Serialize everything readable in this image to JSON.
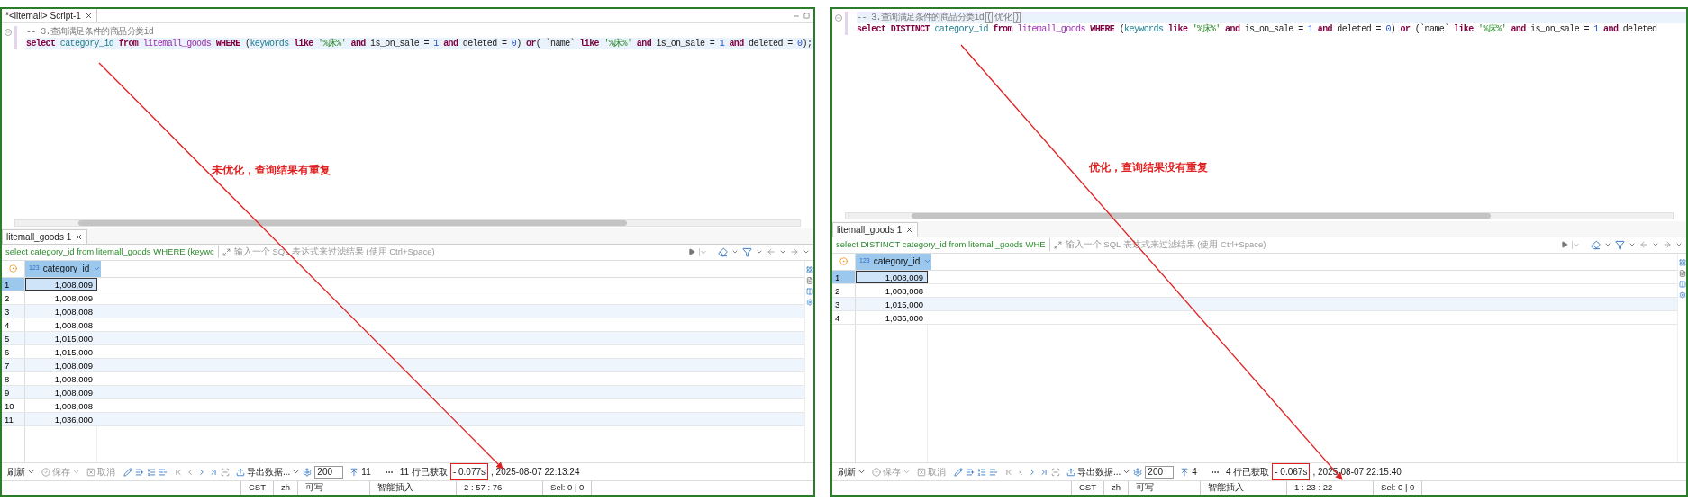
{
  "panels": [
    {
      "editor_tab": {
        "title": "*<litemall> Script-1"
      },
      "code": [
        {
          "current": false,
          "tokens": [
            {
              "kind": "comment",
              "text": "-- 3.查询满足条件的商品分类id"
            }
          ]
        },
        {
          "current": true,
          "tokens": [
            {
              "kind": "keyword",
              "text": "select "
            },
            {
              "kind": "column",
              "text": "category_id "
            },
            {
              "kind": "keyword",
              "text": "from "
            },
            {
              "kind": "table",
              "text": "litemall_goods "
            },
            {
              "kind": "keyword",
              "text": "WHERE "
            },
            {
              "kind": "plain",
              "text": "("
            },
            {
              "kind": "column",
              "text": "keywords "
            },
            {
              "kind": "keyword",
              "text": "like "
            },
            {
              "kind": "string",
              "text": "'%床%' "
            },
            {
              "kind": "keyword",
              "text": "and "
            },
            {
              "kind": "plain",
              "text": "is_on_sale = "
            },
            {
              "kind": "number",
              "text": "1 "
            },
            {
              "kind": "keyword",
              "text": "and "
            },
            {
              "kind": "plain",
              "text": "deleted = "
            },
            {
              "kind": "number",
              "text": "0"
            },
            {
              "kind": "plain",
              "text": ") "
            },
            {
              "kind": "keyword",
              "text": "or"
            },
            {
              "kind": "plain",
              "text": "( `name` "
            },
            {
              "kind": "keyword",
              "text": "like "
            },
            {
              "kind": "string",
              "text": "'%床%' "
            },
            {
              "kind": "keyword",
              "text": "and "
            },
            {
              "kind": "plain",
              "text": "is_on_sale = "
            },
            {
              "kind": "number",
              "text": "1 "
            },
            {
              "kind": "keyword",
              "text": "and "
            },
            {
              "kind": "plain",
              "text": "deleted = "
            },
            {
              "kind": "number",
              "text": "0"
            },
            {
              "kind": "plain",
              "text": ");"
            }
          ]
        }
      ],
      "annotation": "未优化，查询结果有重复",
      "result_tab": "litemall_goods 1",
      "filter_query": "select category_id from litemall_goods WHERE (keywc",
      "filter_placeholder": "输入一个 SQL 表达式来过滤结果 (使用 Ctrl+Space)",
      "column": {
        "type_badge": "123",
        "name": "category_id"
      },
      "rows": [
        {
          "number": "1",
          "value": "1,008,009",
          "selected": true
        },
        {
          "number": "2",
          "value": "1,008,009",
          "selected": false
        },
        {
          "number": "3",
          "value": "1,008,008",
          "selected": false
        },
        {
          "number": "4",
          "value": "1,008,008",
          "selected": false
        },
        {
          "number": "5",
          "value": "1,015,000",
          "selected": false
        },
        {
          "number": "6",
          "value": "1,015,000",
          "selected": false
        },
        {
          "number": "7",
          "value": "1,008,009",
          "selected": false
        },
        {
          "number": "8",
          "value": "1,008,009",
          "selected": false
        },
        {
          "number": "9",
          "value": "1,008,009",
          "selected": false
        },
        {
          "number": "10",
          "value": "1,008,008",
          "selected": false
        },
        {
          "number": "11",
          "value": "1,036,000",
          "selected": false
        }
      ],
      "toolbar": {
        "buttons": [
          {
            "kind": "refresh",
            "label": "刷新",
            "disabled": false
          },
          {
            "kind": "save",
            "label": "保存",
            "disabled": true
          },
          {
            "kind": "cancel",
            "label": "取消",
            "disabled": true
          }
        ],
        "export": "导出数据...",
        "fetch_size": "200",
        "row_count": "11",
        "fetched": "11 行已获取",
        "elapsed": "- 0.077s",
        "timestamp": ", 2025-08-07 22:13:24"
      },
      "status": [
        "CST",
        "zh",
        "可写",
        "智能插入",
        "2 : 57 : 76",
        "Sel: 0 | 0"
      ]
    },
    {
      "code": [
        {
          "current": true,
          "tokens": [
            {
              "kind": "comment",
              "text": "-- 3.查询满足条件的商品分类id"
            },
            {
              "kind": "bracket",
              "text": "("
            },
            {
              "kind": "comment",
              "text": "优化"
            },
            {
              "kind": "bracket",
              "text": ")"
            }
          ]
        },
        {
          "current": false,
          "tokens": [
            {
              "kind": "keyword",
              "text": "select DISTINCT "
            },
            {
              "kind": "column",
              "text": "category_id "
            },
            {
              "kind": "keyword",
              "text": "from "
            },
            {
              "kind": "table",
              "text": "litemall_goods "
            },
            {
              "kind": "keyword",
              "text": "WHERE "
            },
            {
              "kind": "plain",
              "text": "("
            },
            {
              "kind": "column",
              "text": "keywords "
            },
            {
              "kind": "keyword",
              "text": "like "
            },
            {
              "kind": "string",
              "text": "'%床%' "
            },
            {
              "kind": "keyword",
              "text": "and "
            },
            {
              "kind": "plain",
              "text": "is_on_sale = "
            },
            {
              "kind": "number",
              "text": "1 "
            },
            {
              "kind": "keyword",
              "text": "and "
            },
            {
              "kind": "plain",
              "text": "deleted = "
            },
            {
              "kind": "number",
              "text": "0"
            },
            {
              "kind": "plain",
              "text": ") "
            },
            {
              "kind": "keyword",
              "text": "or "
            },
            {
              "kind": "plain",
              "text": "(`name` "
            },
            {
              "kind": "keyword",
              "text": "like "
            },
            {
              "kind": "string",
              "text": "'%床%' "
            },
            {
              "kind": "keyword",
              "text": "and "
            },
            {
              "kind": "plain",
              "text": "is_on_sale = "
            },
            {
              "kind": "number",
              "text": "1 "
            },
            {
              "kind": "keyword",
              "text": "and "
            },
            {
              "kind": "plain",
              "text": "deleted"
            }
          ]
        }
      ],
      "annotation": "优化，查询结果没有重复",
      "result_tab": "litemall_goods 1",
      "filter_query": "select DISTINCT category_id from litemall_goods WHE",
      "filter_placeholder": "输入一个 SQL 表达式来过滤结果 (使用 Ctrl+Space)",
      "column": {
        "type_badge": "123",
        "name": "category_id"
      },
      "rows": [
        {
          "number": "1",
          "value": "1,008,009",
          "selected": true
        },
        {
          "number": "2",
          "value": "1,008,008",
          "selected": false
        },
        {
          "number": "3",
          "value": "1,015,000",
          "selected": false
        },
        {
          "number": "4",
          "value": "1,036,000",
          "selected": false
        }
      ],
      "toolbar": {
        "buttons": [
          {
            "kind": "refresh",
            "label": "刷新",
            "disabled": false
          },
          {
            "kind": "save",
            "label": "保存",
            "disabled": true
          },
          {
            "kind": "cancel",
            "label": "取消",
            "disabled": true
          }
        ],
        "export": "导出数据...",
        "fetch_size": "200",
        "row_count": "4",
        "fetched": "4 行已获取",
        "elapsed": "- 0.067s",
        "timestamp": ", 2025-08-07 22:15:40"
      },
      "status": [
        "CST",
        "zh",
        "可写",
        "智能插入",
        "1 : 23 : 22",
        "Sel: 0 | 0"
      ]
    }
  ]
}
